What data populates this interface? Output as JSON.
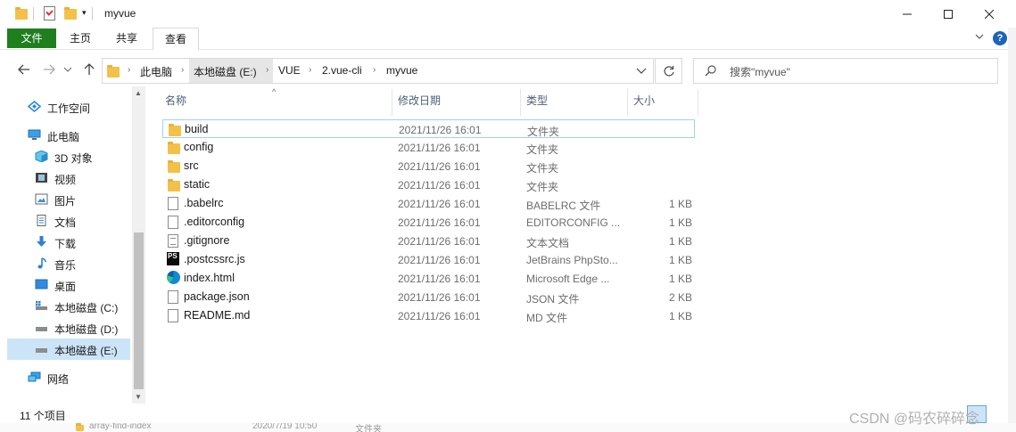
{
  "window": {
    "title": "myvue",
    "controls": [
      "minimize",
      "maximize",
      "close"
    ]
  },
  "ribbon": {
    "tabs": [
      "文件",
      "主页",
      "共享",
      "查看"
    ],
    "help_label": "?"
  },
  "address_bar": {
    "crumbs": [
      "此电脑",
      "本地磁盘 (E:)",
      "VUE",
      "2.vue-cli",
      "myvue"
    ]
  },
  "search": {
    "placeholder": "搜索\"myvue\""
  },
  "nav_pane": {
    "items": [
      {
        "label": "工作空间",
        "icon": "workspace-icon",
        "level": 0
      },
      {
        "label": "此电脑",
        "icon": "computer-icon",
        "level": 0
      },
      {
        "label": "3D 对象",
        "icon": "3d-objects-icon",
        "level": 1
      },
      {
        "label": "视频",
        "icon": "video-icon",
        "level": 1
      },
      {
        "label": "图片",
        "icon": "pictures-icon",
        "level": 1
      },
      {
        "label": "文档",
        "icon": "documents-icon",
        "level": 1
      },
      {
        "label": "下载",
        "icon": "download-icon",
        "level": 1
      },
      {
        "label": "音乐",
        "icon": "music-icon",
        "level": 1
      },
      {
        "label": "桌面",
        "icon": "desktop-icon",
        "level": 1
      },
      {
        "label": "本地磁盘 (C:)",
        "icon": "drive-c-icon",
        "level": 1
      },
      {
        "label": "本地磁盘 (D:)",
        "icon": "drive-icon",
        "level": 1
      },
      {
        "label": "本地磁盘 (E:)",
        "icon": "drive-icon",
        "level": 1,
        "selected": true
      },
      {
        "label": "网络",
        "icon": "network-icon",
        "level": 0
      }
    ]
  },
  "file_list": {
    "columns": [
      "名称",
      "修改日期",
      "类型",
      "大小"
    ],
    "rows": [
      {
        "name": "build",
        "date": "2021/11/26 16:01",
        "type": "文件夹",
        "size": "",
        "icon": "folder-icon",
        "focused": true
      },
      {
        "name": "config",
        "date": "2021/11/26 16:01",
        "type": "文件夹",
        "size": "",
        "icon": "folder-icon"
      },
      {
        "name": "src",
        "date": "2021/11/26 16:01",
        "type": "文件夹",
        "size": "",
        "icon": "folder-icon"
      },
      {
        "name": "static",
        "date": "2021/11/26 16:01",
        "type": "文件夹",
        "size": "",
        "icon": "folder-icon"
      },
      {
        "name": ".babelrc",
        "date": "2021/11/26 16:01",
        "type": "BABELRC 文件",
        "size": "1 KB",
        "icon": "file-icon"
      },
      {
        "name": ".editorconfig",
        "date": "2021/11/26 16:01",
        "type": "EDITORCONFIG ...",
        "size": "1 KB",
        "icon": "file-icon"
      },
      {
        "name": ".gitignore",
        "date": "2021/11/26 16:01",
        "type": "文本文档",
        "size": "1 KB",
        "icon": "text-file-icon"
      },
      {
        "name": ".postcssrc.js",
        "date": "2021/11/26 16:01",
        "type": "JetBrains PhpSto...",
        "size": "1 KB",
        "icon": "phpstorm-icon"
      },
      {
        "name": "index.html",
        "date": "2021/11/26 16:01",
        "type": "Microsoft Edge ...",
        "size": "1 KB",
        "icon": "edge-icon"
      },
      {
        "name": "package.json",
        "date": "2021/11/26 16:01",
        "type": "JSON 文件",
        "size": "2 KB",
        "icon": "file-icon"
      },
      {
        "name": "README.md",
        "date": "2021/11/26 16:01",
        "type": "MD 文件",
        "size": "1 KB",
        "icon": "file-icon"
      }
    ]
  },
  "status_bar": {
    "item_count": "11 个项目"
  },
  "background": {
    "ghost_name": "array-find-index",
    "ghost_date": "2020/7/19 10:50",
    "ghost_type": "文件夹",
    "watermark": "CSDN @码农碎碎念"
  }
}
